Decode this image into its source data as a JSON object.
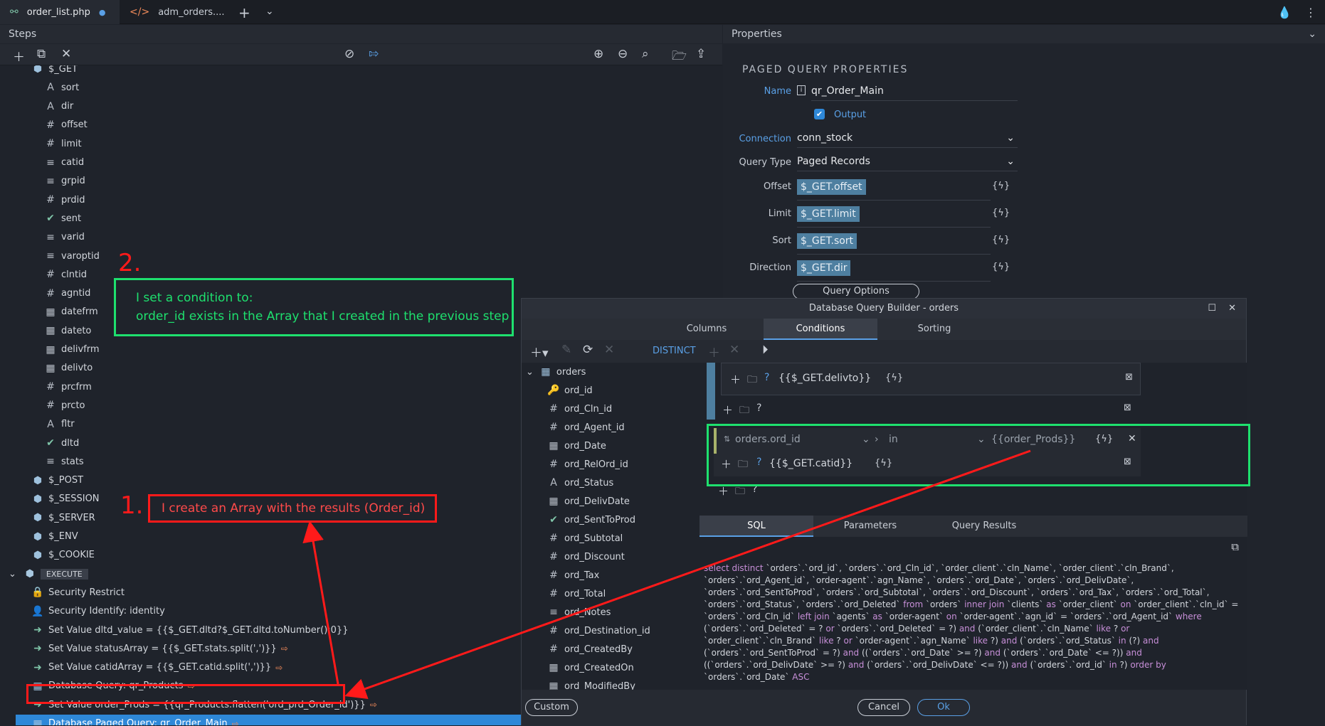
{
  "tabs": [
    {
      "label": "order_list.php",
      "icon": "tree-icon",
      "modified": "●"
    },
    {
      "label": "adm_orders....",
      "icon": "code-icon"
    }
  ],
  "tabbar": {
    "add": "+",
    "more": "⌄",
    "drop": "💧",
    "menu": "⋮"
  },
  "panels": {
    "steps": "Steps",
    "properties": "Properties"
  },
  "tree": [
    {
      "label": "$_GET",
      "icon": "cube",
      "indent": 1
    },
    {
      "label": "sort",
      "icon": "A",
      "indent": 2
    },
    {
      "label": "dir",
      "icon": "A",
      "indent": 2
    },
    {
      "label": "offset",
      "icon": "#",
      "indent": 2
    },
    {
      "label": "limit",
      "icon": "#",
      "indent": 2
    },
    {
      "label": "catid",
      "icon": "≡",
      "indent": 2
    },
    {
      "label": "grpid",
      "icon": "≡",
      "indent": 2
    },
    {
      "label": "prdid",
      "icon": "#",
      "indent": 2
    },
    {
      "label": "sent",
      "icon": "✔",
      "indent": 2
    },
    {
      "label": "varid",
      "icon": "≡",
      "indent": 2
    },
    {
      "label": "varoptid",
      "icon": "≡",
      "indent": 2
    },
    {
      "label": "clntid",
      "icon": "#",
      "indent": 2
    },
    {
      "label": "agntid",
      "icon": "#",
      "indent": 2
    },
    {
      "label": "datefrm",
      "icon": "cal",
      "indent": 2
    },
    {
      "label": "dateto",
      "icon": "cal",
      "indent": 2
    },
    {
      "label": "delivfrm",
      "icon": "cal",
      "indent": 2
    },
    {
      "label": "delivto",
      "icon": "cal",
      "indent": 2
    },
    {
      "label": "prcfrm",
      "icon": "#",
      "indent": 2
    },
    {
      "label": "prcto",
      "icon": "#",
      "indent": 2
    },
    {
      "label": "fltr",
      "icon": "A",
      "indent": 2
    },
    {
      "label": "dltd",
      "icon": "✔",
      "indent": 2
    },
    {
      "label": "stats",
      "icon": "≡",
      "indent": 2
    },
    {
      "label": "$_POST",
      "icon": "cube",
      "indent": 1
    },
    {
      "label": "$_SESSION",
      "icon": "cube",
      "indent": 1
    },
    {
      "label": "$_SERVER",
      "icon": "cube",
      "indent": 1
    },
    {
      "label": "$_ENV",
      "icon": "cube",
      "indent": 1
    },
    {
      "label": "$_COOKIE",
      "icon": "cube",
      "indent": 1
    },
    {
      "label": "EXECUTE",
      "icon": "exec",
      "indent": 0
    },
    {
      "label": "Security Restrict",
      "icon": "lock",
      "indent": 1
    },
    {
      "label": "Security Identify: identity",
      "icon": "user",
      "indent": 1
    },
    {
      "label": "Set Value dltd_value = {{$_GET.dltd?$_GET.dltd.toNumber():0}}",
      "icon": "set",
      "indent": 1
    },
    {
      "label": "Set Value statusArray = {{$_GET.stats.split(',')}}",
      "icon": "set",
      "indent": 1,
      "out": true
    },
    {
      "label": "Set Value catidArray = {{$_GET.catid.split(',')}}",
      "icon": "set",
      "indent": 1,
      "out": true
    },
    {
      "label": "Database Query: qr_Products",
      "icon": "table",
      "indent": 1,
      "out": true
    },
    {
      "label": "Set Value order_Prods = {{qr_Products.flatten('ord_prd_Order_id')}}",
      "icon": "set",
      "indent": 1,
      "out": true
    },
    {
      "label": "Database Paged Query: qr_Order_Main",
      "icon": "table",
      "indent": 1,
      "out": true,
      "selected": true
    }
  ],
  "props": {
    "title": "PAGED QUERY PROPERTIES",
    "name_label": "Name",
    "name_value": "qr_Order_Main",
    "output_label": "Output",
    "connection_label": "Connection",
    "connection_value": "conn_stock",
    "querytype_label": "Query Type",
    "querytype_value": "Paged Records",
    "offset_label": "Offset",
    "offset_value": "$_GET.offset",
    "limit_label": "Limit",
    "limit_value": "$_GET.limit",
    "sort_label": "Sort",
    "sort_value": "$_GET.sort",
    "direction_label": "Direction",
    "direction_value": "$_GET.dir",
    "query_options": "Query Options"
  },
  "dialog": {
    "title": "Database Query Builder - orders",
    "tabs": [
      "Columns",
      "Conditions",
      "Sorting"
    ],
    "distinct": "DISTINCT",
    "table": "orders",
    "columns": [
      {
        "label": "ord_id",
        "icon": "key"
      },
      {
        "label": "ord_Cln_id",
        "icon": "#"
      },
      {
        "label": "ord_Agent_id",
        "icon": "#"
      },
      {
        "label": "ord_Date",
        "icon": "cal"
      },
      {
        "label": "ord_RelOrd_id",
        "icon": "#"
      },
      {
        "label": "ord_Status",
        "icon": "A"
      },
      {
        "label": "ord_DelivDate",
        "icon": "cal"
      },
      {
        "label": "ord_SentToProd",
        "icon": "✔"
      },
      {
        "label": "ord_Subtotal",
        "icon": "#"
      },
      {
        "label": "ord_Discount",
        "icon": "#"
      },
      {
        "label": "ord_Tax",
        "icon": "#"
      },
      {
        "label": "ord_Total",
        "icon": "#"
      },
      {
        "label": "ord_Notes",
        "icon": "≡"
      },
      {
        "label": "ord_Destination_id",
        "icon": "#"
      },
      {
        "label": "ord_CreatedBy",
        "icon": "#"
      },
      {
        "label": "ord_CreatedOn",
        "icon": "cal"
      },
      {
        "label": "ord_ModifiedBy",
        "icon": "cal"
      }
    ],
    "cond_delivto": "{{$_GET.delivto}}",
    "cond_field": "orders.ord_id",
    "cond_op": "in",
    "cond_value": "{{order_Prods}}",
    "cond_catid": "{{$_GET.catid}}",
    "sqltabs": [
      "SQL",
      "Parameters",
      "Query Results"
    ],
    "sql_kw1": "select distinct",
    "sql_text": "`orders`.`ord_id`, `orders`.`ord_Cln_id`, `order_client`.`cln_Name`, `order_client`.`cln_Brand`, `orders`.`ord_Agent_id`, `order-agent`.`agn_Name`, `orders`.`ord_Date`, `orders`.`ord_DelivDate`, `orders`.`ord_SentToProd`, `orders`.`ord_Subtotal`, `orders`.`ord_Discount`, `orders`.`ord_Tax`, `orders`.`ord_Total`, `orders`.`ord_Status`, `orders`.`ord_Deleted`",
    "sql_kw2": "from",
    "sql_text2": "`orders`",
    "sql_kw3": "inner join",
    "sql_text3": "`clients`",
    "sql_kw4": "as",
    "sql_text4": "`order_client`",
    "sql_kw5": "on",
    "sql_text5": "`order_client`.`cln_id` = `orders`.`ord_Cln_id`",
    "sql_kw6": "left join",
    "sql_text6": "`agents`",
    "sql_kw7": "as",
    "sql_text7": "`order-agent`",
    "sql_kw8": "on",
    "sql_text8": "`order-agent`.`agn_id` = `orders`.`ord_Agent_id`",
    "sql_kw9": "where",
    "sql_text9": "(`orders`.`ord_Deleted` = ?",
    "sql_kw10": "or",
    "sql_text10": "`orders`.`ord_Deleted` = ?)",
    "sql_kw11": "and",
    "sql_text11": "(`order_client`.`cln_Name`",
    "sql_kw12": "like",
    "sql_text12": "?",
    "sql_kw13": "or",
    "sql_text13": "`order_client`.`cln_Brand`",
    "sql_kw14": "like",
    "sql_text14": "?",
    "sql_kw15": "or",
    "sql_text15": "`order-agent`.`agn_Name`",
    "sql_kw16": "like",
    "sql_text16": "?)",
    "sql_kw17": "and",
    "sql_text17": "(`orders`.`ord_Status`",
    "sql_kw18": "in",
    "sql_text18": "(?)",
    "sql_kw19": "and",
    "sql_text19": "(`orders`.`ord_SentToProd` = ?)",
    "sql_kw20": "and",
    "sql_text20": "((`orders`.`ord_Date` >= ?)",
    "sql_kw21": "and",
    "sql_text21": "(`orders`.`ord_Date` <= ?))",
    "sql_kw22": "and",
    "sql_text22": "((`orders`.`ord_DelivDate` >= ?)",
    "sql_kw23": "and",
    "sql_text23": "(`orders`.`ord_DelivDate` <= ?))",
    "sql_kw24": "and",
    "sql_text24": "(`orders`.`ord_id`",
    "sql_kw25": "in",
    "sql_text25": "?)",
    "sql_kw26": "order by",
    "sql_text26": "`orders`.`ord_Date`",
    "sql_kw27": "ASC",
    "custom": "Custom",
    "cancel": "Cancel",
    "ok": "Ok"
  },
  "annotations": {
    "n1": "1.",
    "t1": "I create an Array with the results (Order_id)",
    "n2": "2.",
    "t2a": "I set a condition to:",
    "t2b": "order_id exists in the Array that I created in the previous step"
  }
}
